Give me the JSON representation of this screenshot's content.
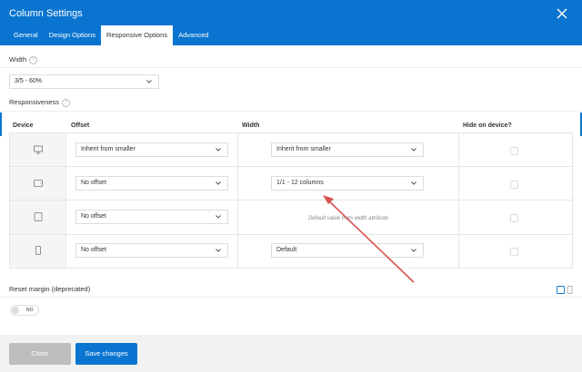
{
  "window": {
    "title": "Column Settings"
  },
  "tabs": [
    {
      "label": "General",
      "active": false
    },
    {
      "label": "Design Options",
      "active": false
    },
    {
      "label": "Responsive Options",
      "active": true
    },
    {
      "label": "Advanced",
      "active": false
    }
  ],
  "width_section": {
    "label": "Width",
    "help_icon": "?",
    "value": "3/5 - 60%"
  },
  "responsiveness": {
    "label": "Responsiveness",
    "help_icon": "?",
    "headers": {
      "device": "Device",
      "offset": "Offset",
      "width": "Width",
      "hide": "Hide on device?"
    },
    "rows": [
      {
        "device_icon": "desktop-icon",
        "offset": "Inherit from smaller",
        "width": "Inherit from smaller",
        "note": "",
        "hidden": false
      },
      {
        "device_icon": "tablet-landscape-icon",
        "offset": "No offset",
        "width": "1/1 - 12 columns",
        "note": "",
        "hidden": false
      },
      {
        "device_icon": "tablet-portrait-icon",
        "offset": "No offset",
        "width": "",
        "note": "Default value from width attribute",
        "hidden": false
      },
      {
        "device_icon": "mobile-icon",
        "offset": "No offset",
        "width": "Default",
        "note": "",
        "hidden": false
      }
    ]
  },
  "reset_margin": {
    "label": "Reset margin (deprecated)",
    "toggle_text": "NO"
  },
  "footer": {
    "close_label": "Close",
    "save_label": "Save changes"
  },
  "colors": {
    "accent": "#0a75d0",
    "arrow": "#d9534f"
  }
}
